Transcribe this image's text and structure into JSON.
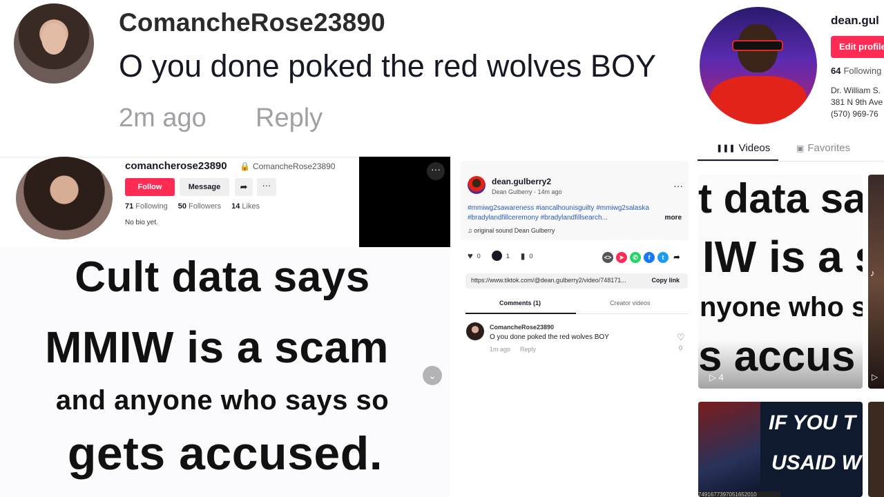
{
  "top_comment": {
    "username": "ComancheRose23890",
    "text": "O you done poked the red wolves BOY",
    "time": "2m ago",
    "reply": "Reply"
  },
  "dean_profile": {
    "username": "dean.gul",
    "edit_label": "Edit profile",
    "following_count": "64",
    "following_label": "Following",
    "bio_line1": "Dr. William S.",
    "bio_line2": "381 N 9th Ave",
    "bio_line3": "(570) 969-76",
    "tabs": [
      {
        "label": "Videos",
        "icon": "grid-icon"
      },
      {
        "label": "Favorites",
        "icon": "bookmark-icon"
      }
    ]
  },
  "rose_profile": {
    "username": "comancherose23890",
    "nickname": "ComancheRose23890",
    "follow_label": "Follow",
    "message_label": "Message",
    "stats": [
      {
        "count": "71",
        "label": "Following"
      },
      {
        "count": "50",
        "label": "Followers"
      },
      {
        "count": "14",
        "label": "Likes"
      }
    ],
    "bio": "No bio yet."
  },
  "big_card": {
    "line1": "Cult data says",
    "line2": "MMIW is a scam",
    "line3": "and anyone who says so",
    "line4": "gets accused."
  },
  "video_details": {
    "author": "dean.gulberry2",
    "subline": "Dean Gulberry · 14m ago",
    "hashtags": "#mmiwg2sawareness #iancalhounisguilty #mmiwg2salaska #bradylandfillceremony #bradylandfillsearch...",
    "more": "more",
    "sound": "original sound Dean Gulberry",
    "likes": "0",
    "comments": "1",
    "saves": "0",
    "link": "https://www.tiktok.com/@dean.gulberry2/video/748171...",
    "copy_label": "Copy link",
    "tab_comments": "Comments (1)",
    "tab_creator": "Creator videos"
  },
  "comment": {
    "username": "ComancheRose23890",
    "text": "O you done poked the red wolves BOY",
    "time": "1m ago",
    "reply": "Reply",
    "likes": "0"
  },
  "grid": {
    "thumb1": {
      "t1": "t data sa",
      "t2": "IW is a s",
      "t3": "nyone who s",
      "t4": "s accus",
      "views": "4"
    },
    "thumb2": {
      "views": ""
    },
    "thumb3": {
      "a": "IF YOU T",
      "b": "USAID W",
      "cap": "7491677397051652010"
    }
  },
  "colors": {
    "accent": "#fe2c55",
    "link": "#2b5db9",
    "muted": "#a0a0a4"
  }
}
